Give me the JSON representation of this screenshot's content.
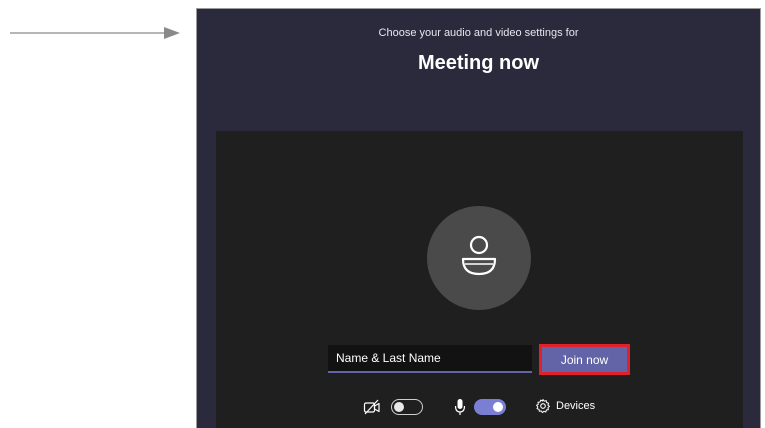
{
  "header": {
    "subtitle": "Choose your audio and video settings for",
    "title": "Meeting now"
  },
  "preview": {
    "avatar_icon": "person-icon"
  },
  "name_field": {
    "value": "Name & Last Name"
  },
  "join_button": {
    "label": "Join now"
  },
  "controls": {
    "camera": {
      "icon": "camera-off-icon",
      "state": "off"
    },
    "microphone": {
      "icon": "microphone-icon",
      "state": "on"
    },
    "devices": {
      "icon": "gear-icon",
      "label": "Devices"
    }
  },
  "colors": {
    "window_bg": "#2b2a3d",
    "preview_bg": "#1f1f1f",
    "accent": "#6264a7",
    "highlight": "#e0202a"
  }
}
